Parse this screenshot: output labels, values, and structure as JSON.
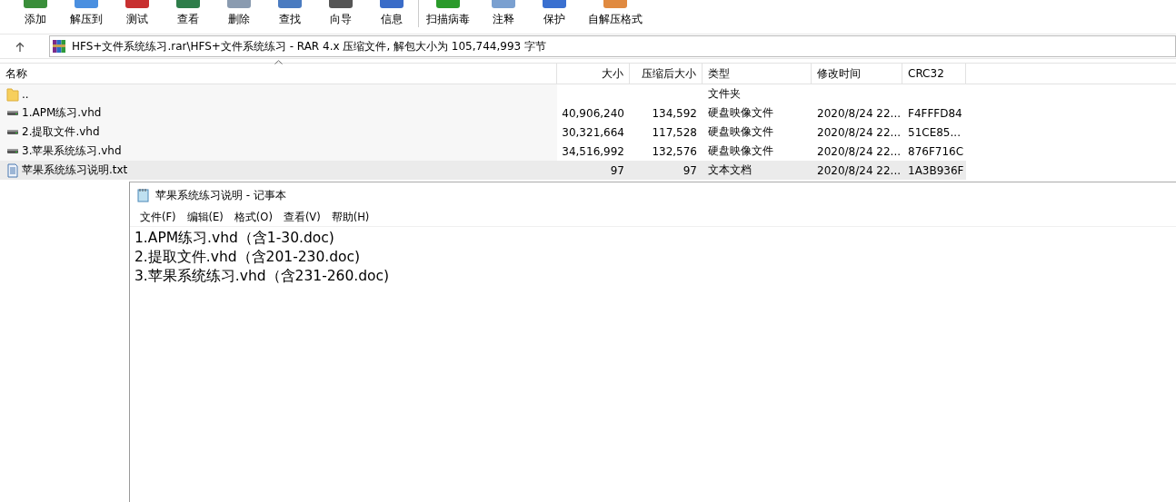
{
  "toolbar": {
    "groups": [
      [
        {
          "label": "添加"
        },
        {
          "label": "解压到"
        },
        {
          "label": "测试"
        },
        {
          "label": "查看"
        },
        {
          "label": "删除"
        },
        {
          "label": "查找"
        },
        {
          "label": "向导"
        },
        {
          "label": "信息"
        }
      ],
      [
        {
          "label": "扫描病毒"
        },
        {
          "label": "注释"
        },
        {
          "label": "保护"
        },
        {
          "label": "自解压格式"
        }
      ]
    ]
  },
  "address": {
    "text": "HFS+文件系统练习.rar\\HFS+文件系统练习 - RAR 4.x 压缩文件, 解包大小为 105,744,993 字节"
  },
  "table": {
    "columns": [
      {
        "label": "名称",
        "sorted": true
      },
      {
        "label": "大小",
        "sorted": false
      },
      {
        "label": "压缩后大小",
        "sorted": false
      },
      {
        "label": "类型",
        "sorted": false
      },
      {
        "label": "修改时间",
        "sorted": false
      },
      {
        "label": "CRC32",
        "sorted": false
      }
    ],
    "rows": [
      {
        "kind": "folder",
        "name": "..",
        "type": "文件夹",
        "selected": false
      },
      {
        "kind": "disk",
        "name": "1.APM练习.vhd",
        "size": "40,906,240",
        "packed": "134,592",
        "type": "硬盘映像文件",
        "modified": "2020/8/24 22...",
        "crc": "F4FFFD84",
        "selected": false
      },
      {
        "kind": "disk",
        "name": "2.提取文件.vhd",
        "size": "30,321,664",
        "packed": "117,528",
        "type": "硬盘映像文件",
        "modified": "2020/8/24 22...",
        "crc": "51CE85...",
        "selected": false
      },
      {
        "kind": "disk",
        "name": "3.苹果系统练习.vhd",
        "size": "34,516,992",
        "packed": "132,576",
        "type": "硬盘映像文件",
        "modified": "2020/8/24 22...",
        "crc": "876F716C",
        "selected": false
      },
      {
        "kind": "text",
        "name": "苹果系统练习说明.txt",
        "size": "97",
        "packed": "97",
        "type": "文本文档",
        "modified": "2020/8/24 22...",
        "crc": "1A3B936F",
        "selected": true
      }
    ]
  },
  "notepad": {
    "title": "苹果系统练习说明 - 记事本",
    "menu": [
      "文件(F)",
      "编辑(E)",
      "格式(O)",
      "查看(V)",
      "帮助(H)"
    ],
    "lines": [
      "1.APM练习.vhd（含1-30.doc)",
      "2.提取文件.vhd（含201-230.doc)",
      "3.苹果系统练习.vhd（含231-260.doc)"
    ]
  }
}
